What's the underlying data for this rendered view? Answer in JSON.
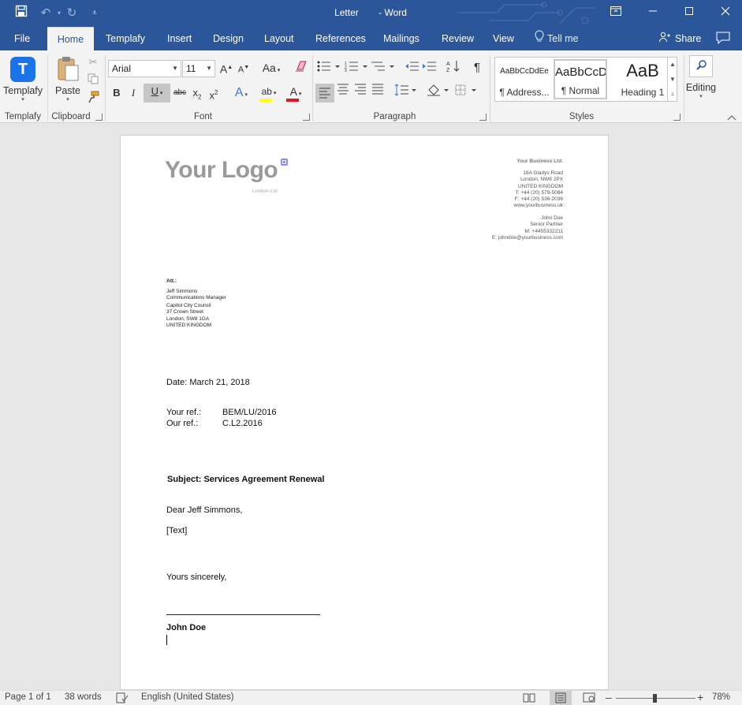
{
  "window": {
    "title": "Letter",
    "separator": "-",
    "app": "Word",
    "icons": [
      "save-icon",
      "undo-icon",
      "redo-icon",
      "customize-qat-icon",
      "ribbon-display-options-icon",
      "minimize-icon",
      "restore-icon",
      "close-icon"
    ]
  },
  "tabs": {
    "items": [
      {
        "label": "File"
      },
      {
        "label": "Home"
      },
      {
        "label": "Templafy"
      },
      {
        "label": "Insert"
      },
      {
        "label": "Design"
      },
      {
        "label": "Layout"
      },
      {
        "label": "References"
      },
      {
        "label": "Mailings"
      },
      {
        "label": "Review"
      },
      {
        "label": "View"
      }
    ],
    "active": "Home",
    "tell_me": "Tell me",
    "share": "Share"
  },
  "ribbon": {
    "templafy": {
      "button": "Templafy",
      "group": "Templafy",
      "icon_letter": "T"
    },
    "clipboard": {
      "paste": "Paste",
      "group": "Clipboard"
    },
    "font": {
      "family": "Arial",
      "size": "11",
      "group": "Font",
      "case_label": "Aa",
      "grow_label": "A",
      "shrink_label": "A",
      "bold": "B",
      "italic": "I",
      "underline": "U",
      "strike": "abc",
      "subscript": "x",
      "subscript_mark": "2",
      "superscript": "x",
      "superscript_mark": "2",
      "effects": "A",
      "highlight": "ab",
      "color": "A",
      "color_hex": "#e81123",
      "highlight_hex": "#ffff00"
    },
    "paragraph": {
      "group": "Paragraph",
      "pilcrow": "¶"
    },
    "styles": {
      "group": "Styles",
      "items": [
        {
          "preview": "AaBbCcDdEe",
          "name": "¶ Address..."
        },
        {
          "preview": "AaBbCcD",
          "name": "¶ Normal"
        },
        {
          "preview": "AaB",
          "name": "Heading 1"
        }
      ]
    },
    "editing": {
      "label": "Editing"
    }
  },
  "letter": {
    "logo": {
      "text": "Your Logo",
      "tag": "London–Ltd",
      "accent": "#8a8cf0"
    },
    "sender": {
      "company": "Your Business Ltd.",
      "lines": [
        "18A Gladys Road",
        "London, NW6 2PX",
        "UNITED KINGDOM",
        "T: +44 (20) 579-5084",
        "F: +44 (20) 536-2036",
        "www.yourbusiness.uk"
      ],
      "person_lines": [
        "John Doe",
        "Senior Partner",
        "M: +4455332211",
        "E: johndoe@yourbusiness.com"
      ]
    },
    "recipient": {
      "att": "Att.:",
      "name_lines": [
        "Jeff Simmons",
        "Communications Manager"
      ],
      "address_lines": [
        "Capitol City Council",
        "37 Crown Street",
        "London, SW8 1GA",
        "UNITED KINGDOM"
      ]
    },
    "date": "Date: March 21, 2018",
    "refs": [
      {
        "label": "Your ref.:",
        "value": "BEM/LU/2016"
      },
      {
        "label": "Our ref.:",
        "value": "C.L2.2016"
      }
    ],
    "subject": "Subject: Services Agreement Renewal",
    "salutation": "Dear Jeff Simmons,",
    "body": "[Text]",
    "closing": "Yours sincerely,",
    "signature": "John Doe"
  },
  "status": {
    "page": "Page 1 of 1",
    "words": "38 words",
    "language": "English (United States)",
    "zoom_minus": "–",
    "zoom_plus": "+",
    "zoom": "78%",
    "zoom_fraction": 0.49
  }
}
